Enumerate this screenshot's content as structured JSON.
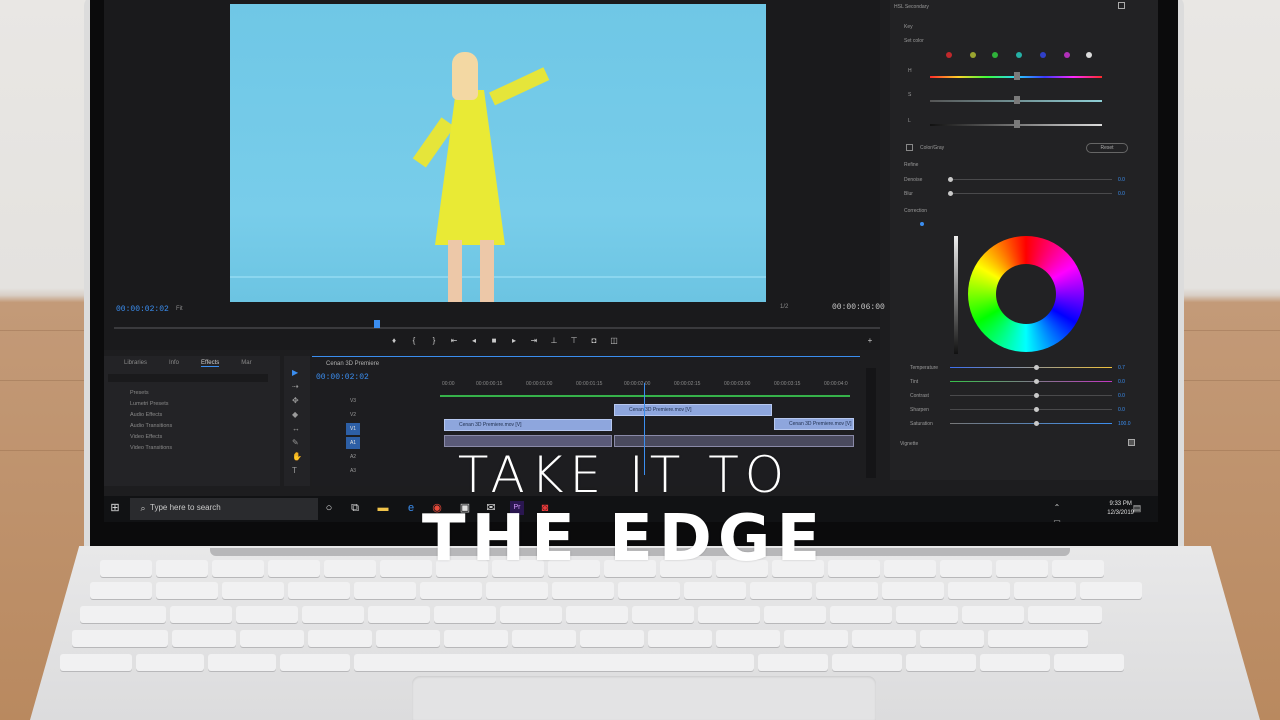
{
  "overlay": {
    "line1": "TAKE IT TO",
    "line2": "THE EDGE"
  },
  "program_monitor": {
    "timecode_current": "00:00:02:02",
    "timecode_total": "00:00:06:00",
    "fit_label": "Fit",
    "fraction": "1/2"
  },
  "lumetri": {
    "section": "HSL Secondary",
    "key_label": "Key",
    "set_color_label": "Set color",
    "h": "H",
    "s": "S",
    "l": "L",
    "color_gray_label": "Color/Gray",
    "reset_label": "Reset",
    "refine_label": "Refine",
    "denoise_label": "Denoise",
    "denoise_val": "0.0",
    "blur_label": "Blur",
    "blur_val": "0.0",
    "correction_label": "Correction",
    "temperature_label": "Temperature",
    "temperature_val": "0.7",
    "tint_label": "Tint",
    "tint_val": "0.0",
    "contrast_label": "Contrast",
    "contrast_val": "0.0",
    "sharpen_label": "Sharpen",
    "sharpen_val": "0.0",
    "saturation_label": "Saturation",
    "saturation_val": "100.0",
    "vignette_label": "Vignette"
  },
  "effects_panel": {
    "tabs": [
      "Libraries",
      "Info",
      "Effects",
      "Mar"
    ],
    "items": [
      "Presets",
      "Lumetri Presets",
      "Audio Effects",
      "Audio Transitions",
      "Video Effects",
      "Video Transitions"
    ]
  },
  "timeline": {
    "sequence_title": "Cenan 3D Premiere",
    "timecode": "00:00:02:02",
    "ruler": [
      "00:00",
      "00:00:00:15",
      "00:00:01:00",
      "00:00:01:15",
      "00:00:02:00",
      "00:00:02:15",
      "00:00:03:00",
      "00:00:03:15",
      "00:00:04:0"
    ],
    "tracks": [
      "V3",
      "V2",
      "V1",
      "A1",
      "A2",
      "A3"
    ],
    "clip_a": "Cenan 3D Premiere.mov [V]",
    "clip_b": "Cenan 3D Premiere.mov [V]",
    "clip_c": "Cenan 3D Premiere.mov [V]"
  },
  "taskbar": {
    "search_placeholder": "Type here to search",
    "time": "9:33 PM",
    "date": "12/3/2019"
  },
  "colors": {
    "accent": "#3b8ef0",
    "coat": "#e9ea35",
    "backdrop": "#72c9e8",
    "clip": "#8ea6dd"
  }
}
